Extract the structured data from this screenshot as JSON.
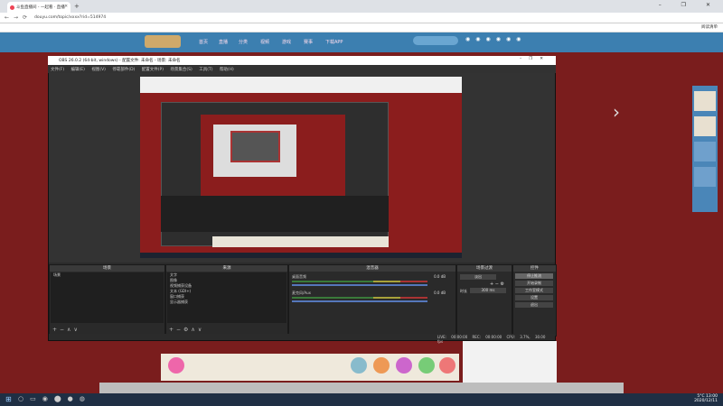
{
  "browser": {
    "tab_title": "斗鱼直播间 - 一起看 · 直播",
    "url": "douyu.com/topic/xxxx?rid=514974",
    "bookmarks_right": "阅读清单",
    "window_controls": "–  ❐  ✕"
  },
  "site_nav": [
    "首页",
    "直播",
    "分类",
    "视频",
    "游戏",
    "赛事",
    "下载APP"
  ],
  "obs": {
    "title": "OBS 26.0.2 (64-bit, windows) - 配置文件: 未命名 - 场景: 未命名",
    "menu": "文件(F) 编辑(E) 视图(V) 停靠部件(D) 配置文件(P) 场景集合(S) 工具(T) 帮助(H)",
    "docks": {
      "scenes": {
        "header": "场景",
        "items": [
          "场景"
        ]
      },
      "sources": {
        "header": "来源",
        "items": [
          "文字",
          "图像",
          "视频捕获设备",
          "文本 (GDI+)",
          "窗口捕获",
          "显示器捕获"
        ]
      },
      "mixer": {
        "header": "混音器",
        "tracks": [
          {
            "name": "桌面音频",
            "level": "0.0 dB"
          },
          {
            "name": "麦克风/Aux",
            "level": "0.0 dB"
          }
        ]
      },
      "transitions": {
        "header": "场景过渡",
        "type": "淡出",
        "duration_label": "时长",
        "duration": "300 ms"
      },
      "controls": {
        "header": "控件",
        "buttons": [
          "停止推流",
          "开始录制",
          "工作室模式",
          "设置",
          "退出"
        ]
      }
    },
    "status": "LIVE: 00:00:00  REC: 00:00:00  CPU: 3.7%, 30.00 fps"
  },
  "taskbar": {
    "time": "13:00",
    "date": "2020/12/11",
    "temp": "5°C"
  },
  "colors": {
    "page_bg": "#7a1d1d",
    "obs_bg": "#2b2b2b",
    "taskbar": "#1f2f44"
  }
}
